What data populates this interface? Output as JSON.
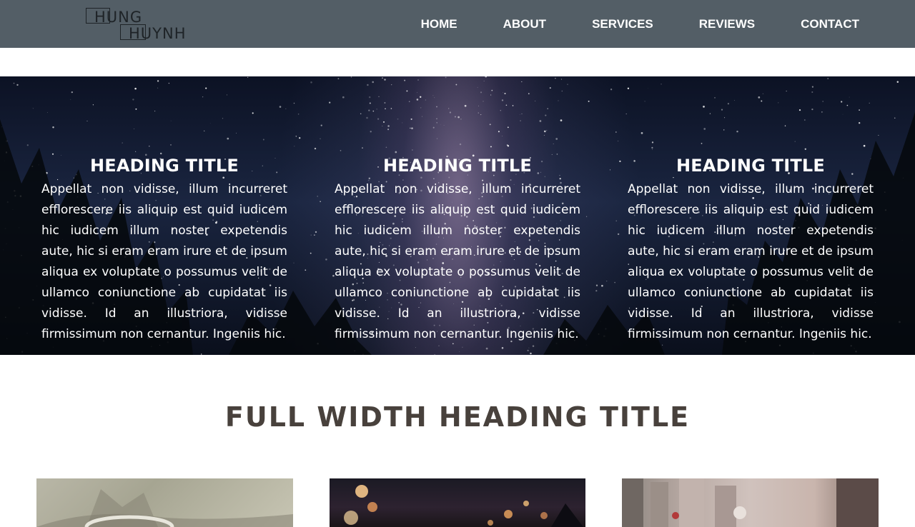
{
  "brand": {
    "logo_line1": "HUNG",
    "logo_line2": "HUYNH"
  },
  "nav": {
    "items": [
      {
        "label": "HOME"
      },
      {
        "label": "ABOUT"
      },
      {
        "label": "SERVICES"
      },
      {
        "label": "REVIEWS"
      },
      {
        "label": "CONTACT"
      }
    ]
  },
  "hero": {
    "columns": [
      {
        "title": "HEADING TITLE",
        "body": "Appellat non vidisse, illum incurreret efflorescere iis aliquip est quid iudicem hic iudicem illum noster expetendis aute, hic si eram eram irure et de ipsum aliqua ex voluptate o possumus velit de ullamco coniunctione ab cupidatat iis vidisse. Id an illustriora, vidisse firmissimum non cernantur. Ingeniis hic."
      },
      {
        "title": "HEADING TITLE",
        "body": "Appellat non vidisse, illum incurreret efflorescere iis aliquip est quid iudicem hic iudicem illum noster expetendis aute, hic si eram eram irure et de ipsum aliqua ex voluptate o possumus velit de ullamco coniunctione ab cupidatat iis vidisse. Id an illustriora, vidisse firmissimum non cernantur. Ingeniis hic."
      },
      {
        "title": "HEADING TITLE",
        "body": "Appellat non vidisse, illum incurreret efflorescere iis aliquip est quid iudicem hic iudicem illum noster expetendis aute, hic si eram eram irure et de ipsum aliqua ex voluptate o possumus velit de ullamco coniunctione ab cupidatat iis vidisse. Id an illustriora, vidisse firmissimum non cernantur. Ingeniis hic."
      }
    ]
  },
  "section": {
    "title": "FULL WIDTH HEADING TITLE"
  },
  "colors": {
    "nav_bg": "#535e66",
    "heading_text": "#48413c",
    "hero_text": "#ffffff"
  }
}
